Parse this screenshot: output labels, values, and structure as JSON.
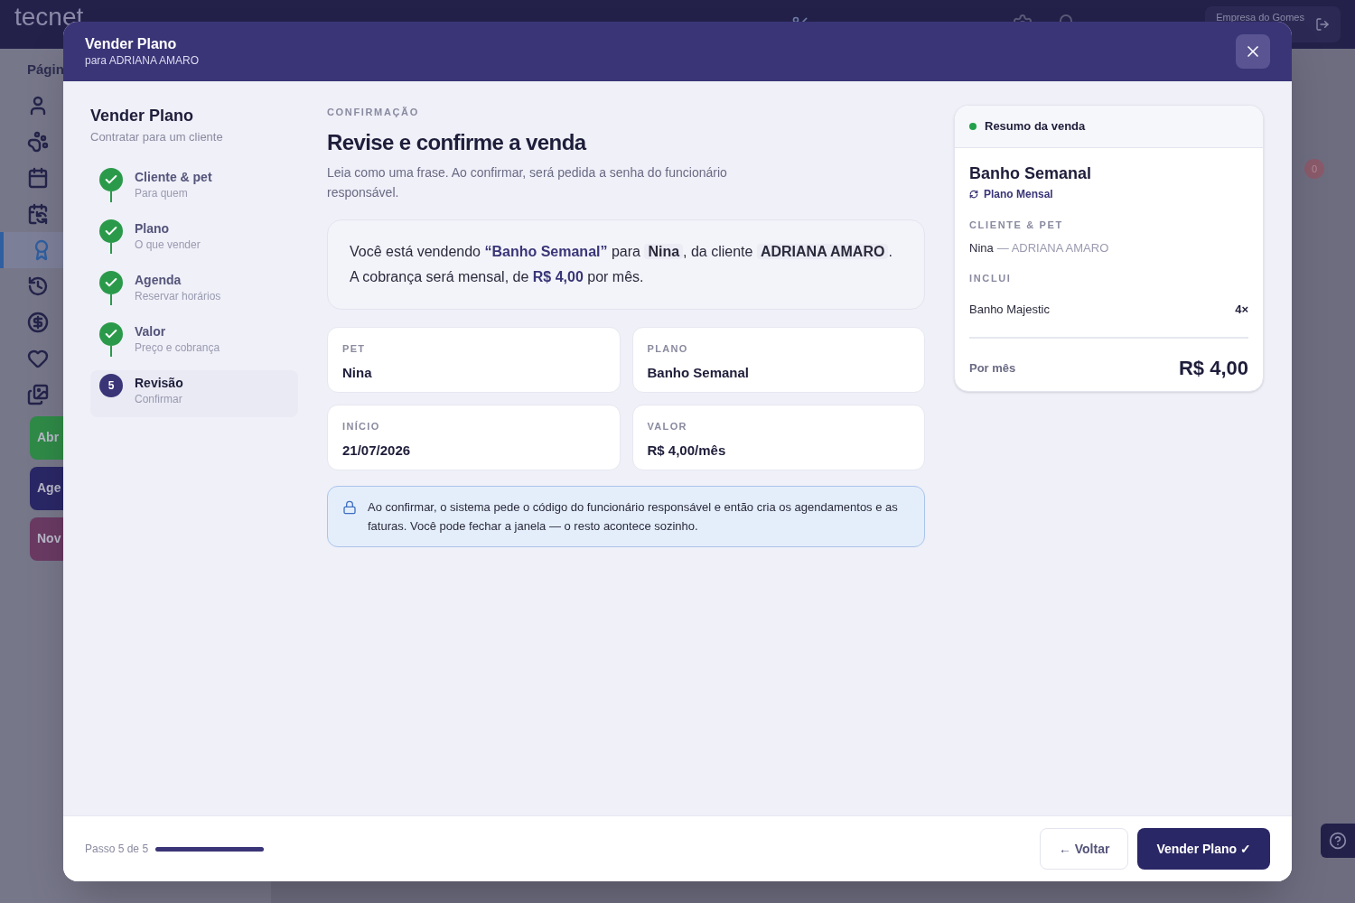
{
  "app": {
    "logo": "tecnet",
    "company": "Empresa do Gomes",
    "sidebar_heading": "Págin",
    "sidebar_items": [
      {
        "selected": false
      },
      {
        "selected": false
      },
      {
        "selected": false
      },
      {
        "selected": false
      },
      {
        "selected": true
      },
      {
        "selected": false
      },
      {
        "selected": false
      },
      {
        "selected": false
      },
      {
        "selected": false
      }
    ],
    "sidebar_buttons": [
      {
        "label": "Abr",
        "color": "#2f8a47"
      },
      {
        "label": "Age",
        "color": "#2a2766"
      },
      {
        "label": "Nov",
        "color": "#6a3a63"
      }
    ],
    "badge": "0"
  },
  "modal": {
    "title": "Vender Plano",
    "subtitle": "para ADRIANA AMARO",
    "wizard": {
      "title": "Vender Plano",
      "subtitle": "Contratar para um cliente",
      "steps": [
        {
          "label": "Cliente & pet",
          "hint": "Para quem",
          "done": true,
          "selected": false
        },
        {
          "label": "Plano",
          "hint": "O que vender",
          "done": true,
          "selected": false
        },
        {
          "label": "Agenda",
          "hint": "Reservar horários",
          "done": true,
          "selected": false
        },
        {
          "label": "Valor",
          "hint": "Preço e cobrança",
          "done": true,
          "selected": false
        },
        {
          "label": "Revisão",
          "hint": "Confirmar",
          "done": false,
          "selected": true,
          "number": "5"
        }
      ]
    },
    "review": {
      "eyebrow": "CONFIRMAÇÃO",
      "heading": "Revise e confirme a venda",
      "intro": "Leia como uma frase. Ao confirmar, será pedida a senha do funcionário responsável.",
      "sentence": [
        {
          "kind": "plain",
          "text": "Você está vendendo "
        },
        {
          "kind": "accent",
          "text": "“Banho Semanal”"
        },
        {
          "kind": "plain",
          "text": " para "
        },
        {
          "kind": "chip",
          "text": "Nina"
        },
        {
          "kind": "plain",
          "text": ", da cliente "
        },
        {
          "kind": "chip",
          "text": "ADRIANA AMARO"
        },
        {
          "kind": "plain",
          "text": "."
        },
        {
          "kind": "break"
        },
        {
          "kind": "plain",
          "text": "A cobrança será mensal, de "
        },
        {
          "kind": "accent",
          "text": "R$ 4,00"
        },
        {
          "kind": "plain",
          "text": " por mês."
        }
      ],
      "fields": [
        {
          "label": "PET",
          "value": "Nina"
        },
        {
          "label": "PLANO",
          "value": "Banho Semanal"
        },
        {
          "label": "INÍCIO",
          "value": "21/07/2026"
        },
        {
          "label": "VALOR",
          "value": "R$ 4,00/mês"
        }
      ],
      "notice": "Ao confirmar, o sistema pede o código do funcionário responsável e então cria os agendamentos e as faturas. Você pode fechar a janela — o resto acontece sozinho."
    },
    "summary": {
      "title": "Resumo da venda",
      "plan": "Banho Semanal",
      "plan_type": "Plano Mensal",
      "client_label": "CLIENTE & PET",
      "pet": "Nina",
      "client": "— ADRIANA AMARO",
      "includes_label": "INCLUI",
      "includes": [
        {
          "name": "Banho Majestic",
          "qty": "4×"
        }
      ],
      "total_label": "Por mês",
      "total": "R$ 4,00"
    },
    "footer": {
      "step": "Passo 5 de 5",
      "progress": {
        "level": 1
      },
      "back": "← Voltar",
      "confirm": "Vender Plano ✓"
    }
  }
}
